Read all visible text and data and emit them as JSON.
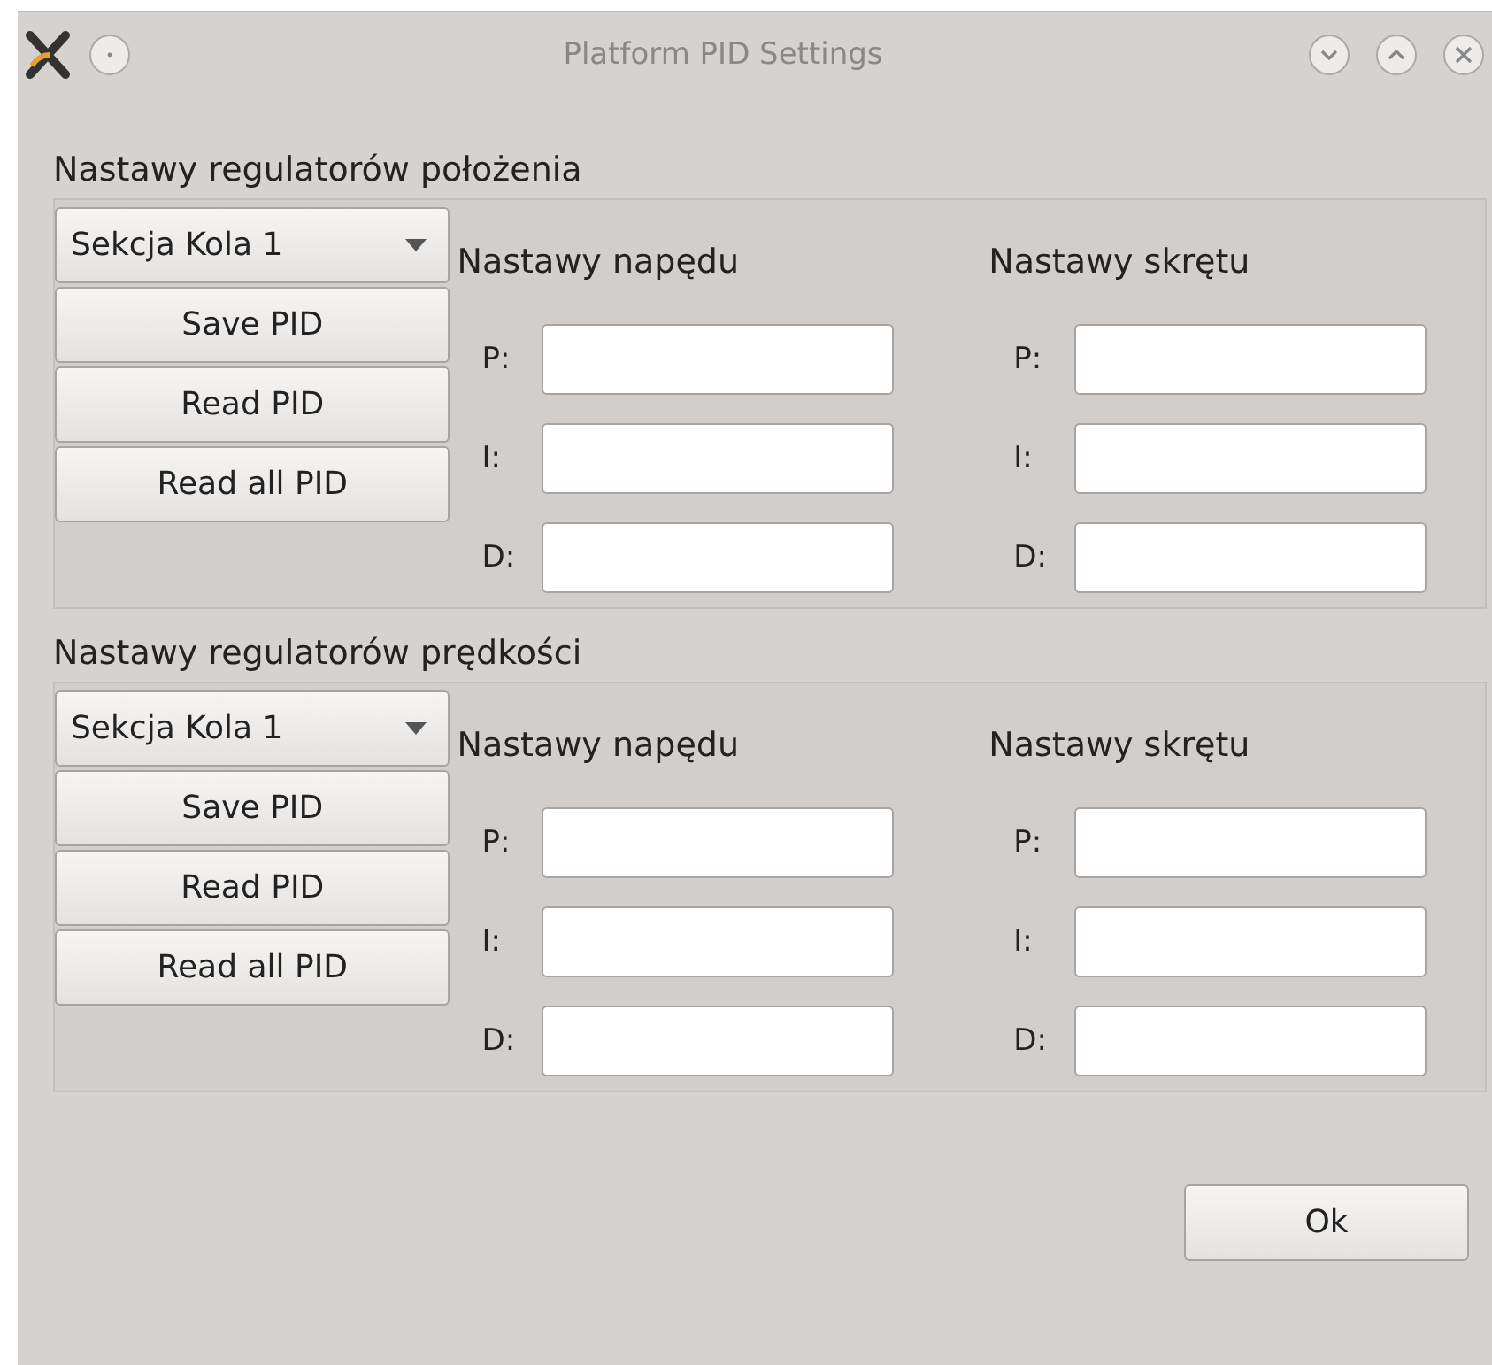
{
  "window": {
    "title": "Platform PID Settings"
  },
  "sections": [
    {
      "heading": "Nastawy regulatorów położenia",
      "dropdown": "Sekcja Kola 1",
      "buttons": [
        "Save PID",
        "Read PID",
        "Read all PID"
      ],
      "groups": [
        {
          "heading": "Nastawy napędu",
          "fields": [
            {
              "label": "P:"
            },
            {
              "label": "I:"
            },
            {
              "label": "D:"
            }
          ]
        },
        {
          "heading": "Nastawy skrętu",
          "fields": [
            {
              "label": "P:"
            },
            {
              "label": "I:"
            },
            {
              "label": "D:"
            }
          ]
        }
      ]
    },
    {
      "heading": "Nastawy regulatorów prędkości",
      "dropdown": "Sekcja Kola 1",
      "buttons": [
        "Save PID",
        "Read PID",
        "Read all PID"
      ],
      "groups": [
        {
          "heading": "Nastawy napędu",
          "fields": [
            {
              "label": "P:"
            },
            {
              "label": "I:"
            },
            {
              "label": "D:"
            }
          ]
        },
        {
          "heading": "Nastawy skrętu",
          "fields": [
            {
              "label": "P:"
            },
            {
              "label": "I:"
            },
            {
              "label": "D:"
            }
          ]
        }
      ]
    }
  ],
  "ok_button": "Ok"
}
